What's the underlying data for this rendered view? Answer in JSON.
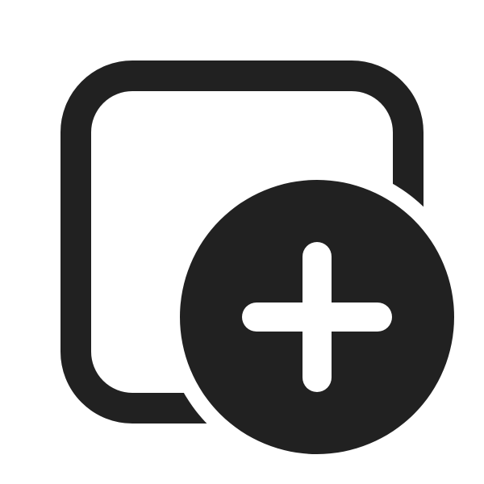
{
  "icon": {
    "name": "square-add-icon",
    "color": "#212121",
    "background": "#ffffff"
  }
}
